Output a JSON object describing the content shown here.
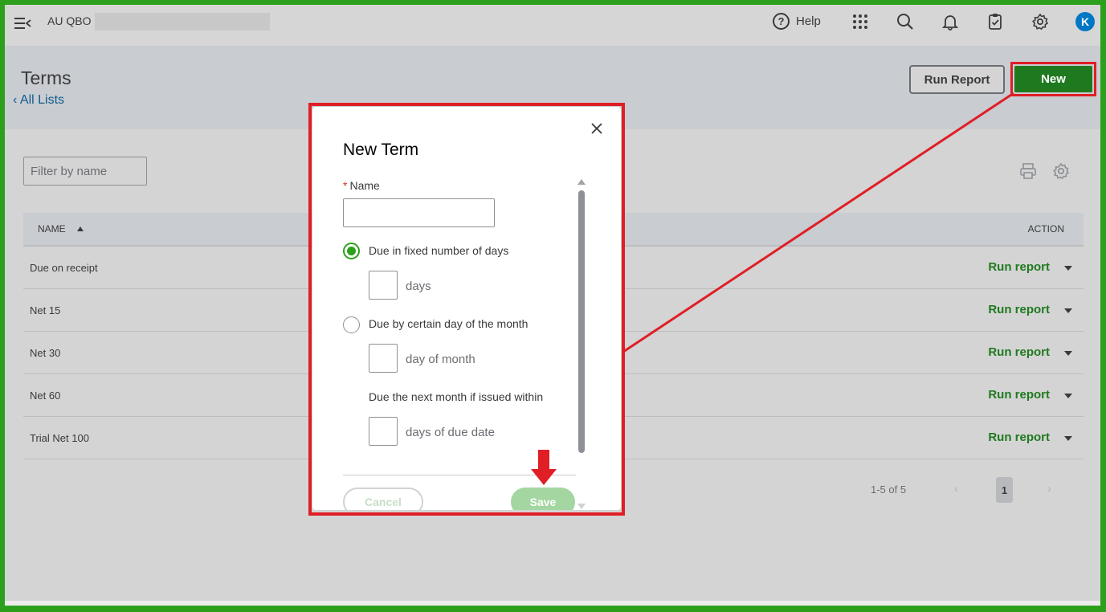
{
  "topbar": {
    "company": "AU QBO",
    "help_label": "Help",
    "avatar_initial": "K"
  },
  "page": {
    "title": "Terms",
    "back_link": "All Lists",
    "run_report_button": "Run Report",
    "new_button": "New"
  },
  "filter": {
    "placeholder": "Filter by name"
  },
  "table": {
    "columns": [
      "NAME",
      "ACTION"
    ],
    "rows": [
      {
        "name": "Due on receipt",
        "action": "Run report"
      },
      {
        "name": "Net 15",
        "action": "Run report"
      },
      {
        "name": "Net 30",
        "action": "Run report"
      },
      {
        "name": "Net 60",
        "action": "Run report"
      },
      {
        "name": "Trial Net 100",
        "action": "Run report"
      }
    ]
  },
  "pager": {
    "summary": "1-5 of 5",
    "current_page": "1",
    "prev": "‹",
    "next": "›"
  },
  "modal": {
    "title": "New Term",
    "name_label": "Name",
    "required_mark": "*",
    "name_value": "",
    "option_fixed_days": "Due in fixed number of days",
    "option_fixed_days_selected": true,
    "days_unit": "days",
    "option_day_of_month": "Due by certain day of the month",
    "option_day_of_month_selected": false,
    "day_of_month_unit": "day of month",
    "next_month_label": "Due the next month if issued within",
    "days_of_due_date_unit": "days of due date",
    "cancel_button": "Cancel",
    "save_button": "Save"
  },
  "colors": {
    "accent_green": "#2ca01c",
    "new_button_green": "#1f7a1f",
    "highlight_red": "#e01e26",
    "link_blue": "#0e5c8f",
    "avatar_blue": "#0077c5"
  }
}
